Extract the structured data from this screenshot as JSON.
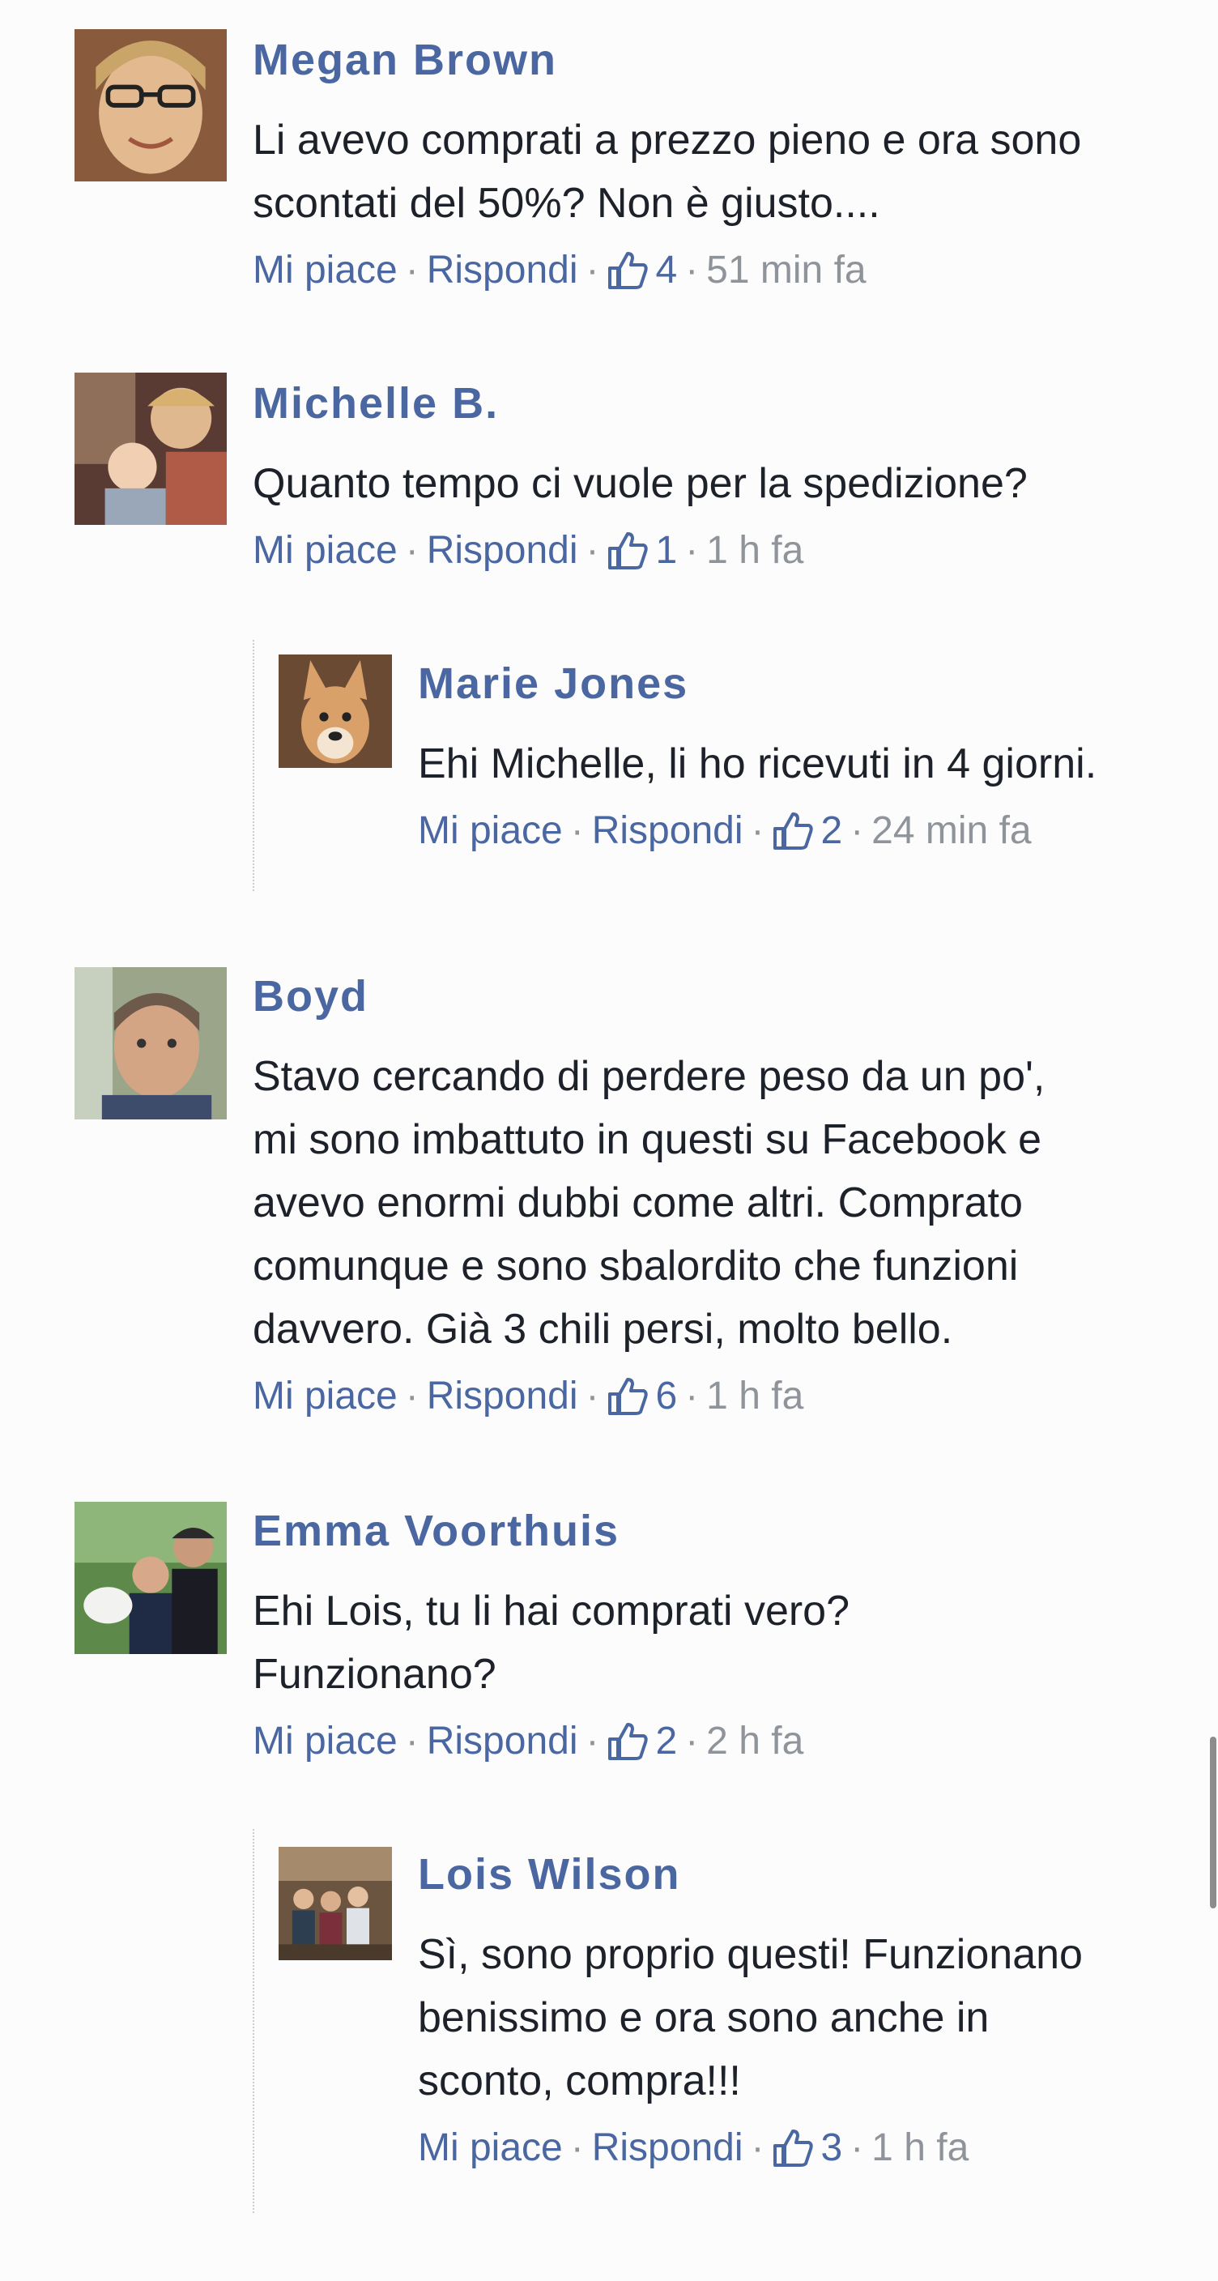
{
  "actions": {
    "like_label": "Mi piace",
    "reply_label": "Rispondi",
    "separator": "·",
    "like_icon": "thumbs-up-icon"
  },
  "colors": {
    "name": "#4b67a1",
    "text": "#1d2129",
    "meta": "#8f949b"
  },
  "comments": [
    {
      "name": "Megan Brown",
      "text": "Li avevo comprati a prezzo pieno e ora sono\nscontati del 50%? Non è giusto....",
      "likes": "4",
      "time": "51 min fa"
    },
    {
      "name": "Michelle B.",
      "text": "Quanto tempo ci vuole per la spedizione?",
      "likes": "1",
      "time": "1 h fa",
      "replies": [
        {
          "name": "Marie Jones",
          "text": "Ehi Michelle, li ho ricevuti in 4 giorni.",
          "likes": "2",
          "time": "24 min fa"
        }
      ]
    },
    {
      "name": "Boyd",
      "text": "Stavo cercando di perdere peso da un po',\nmi sono imbattuto in questi su Facebook e\navevo enormi dubbi come altri. Comprato\ncomunque e sono sbalordito che funzioni\ndavvero. Già 3 chili persi, molto bello.",
      "likes": "6",
      "time": "1 h fa"
    },
    {
      "name": "Emma Voorthuis",
      "text": "Ehi Lois, tu li hai comprati vero?\nFunzionano?",
      "likes": "2",
      "time": "2 h fa",
      "replies": [
        {
          "name": "Lois Wilson",
          "text": "Sì, sono proprio questi! Funzionano\nbenissimo e ora sono anche in\nsconto, compra!!!",
          "likes": "3",
          "time": "1 h fa"
        }
      ]
    }
  ]
}
